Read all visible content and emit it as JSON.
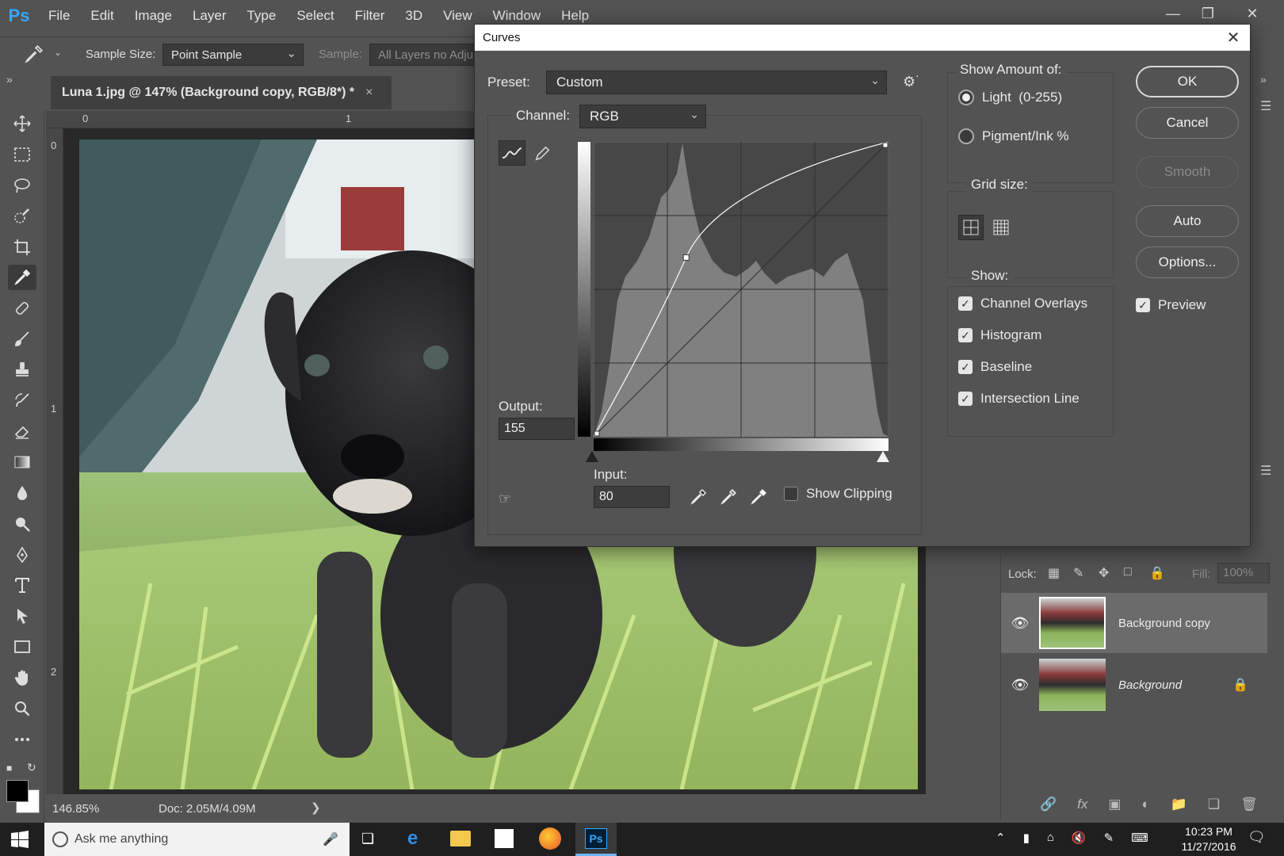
{
  "app": {
    "logo": "Ps",
    "menus": [
      "File",
      "Edit",
      "Image",
      "Layer",
      "Type",
      "Select",
      "Filter",
      "3D",
      "View",
      "Window",
      "Help"
    ]
  },
  "options_bar": {
    "sample_size_label": "Sample Size:",
    "sample_size_value": "Point Sample",
    "sample_label": "Sample:",
    "sample_value": "All Layers no Adju"
  },
  "document": {
    "tab_title": "Luna 1.jpg @ 147% (Background copy, RGB/8*) *",
    "close": "×",
    "zoom": "146.85%",
    "doc_size": "Doc: 2.05M/4.09M",
    "ruler_top": [
      "0",
      "1"
    ],
    "ruler_left": [
      "0",
      "1",
      "2"
    ]
  },
  "curves_dialog": {
    "title": "Curves",
    "preset_label": "Preset:",
    "preset_value": "Custom",
    "channel_label": "Channel:",
    "channel_value": "RGB",
    "output_label": "Output:",
    "output_value": "155",
    "input_label": "Input:",
    "input_value": "80",
    "show_clipping_label": "Show Clipping",
    "show_clipping_checked": false,
    "show_amount_title": "Show Amount of:",
    "show_amount_options": [
      {
        "label": "Light  (0-255)",
        "selected": true
      },
      {
        "label": "Pigment/Ink %",
        "selected": false
      }
    ],
    "grid_size_title": "Grid size:",
    "show_title": "Show:",
    "show_options": [
      {
        "label": "Channel Overlays",
        "checked": true
      },
      {
        "label": "Histogram",
        "checked": true
      },
      {
        "label": "Baseline",
        "checked": true
      },
      {
        "label": "Intersection Line",
        "checked": true
      }
    ],
    "buttons": {
      "ok": "OK",
      "cancel": "Cancel",
      "smooth": "Smooth",
      "auto": "Auto",
      "options": "Options..."
    },
    "preview_label": "Preview",
    "preview_checked": true
  },
  "layers_panel": {
    "lock_label": "Lock:",
    "fill_label": "Fill:",
    "fill_value": "100%",
    "layers": [
      {
        "name": "Background copy",
        "selected": true,
        "locked": false
      },
      {
        "name": "Background",
        "selected": false,
        "locked": true
      }
    ]
  },
  "taskbar": {
    "search_placeholder": "Ask me anything",
    "time": "10:23 PM",
    "date": "11/27/2016",
    "ps_label": "Ps"
  }
}
